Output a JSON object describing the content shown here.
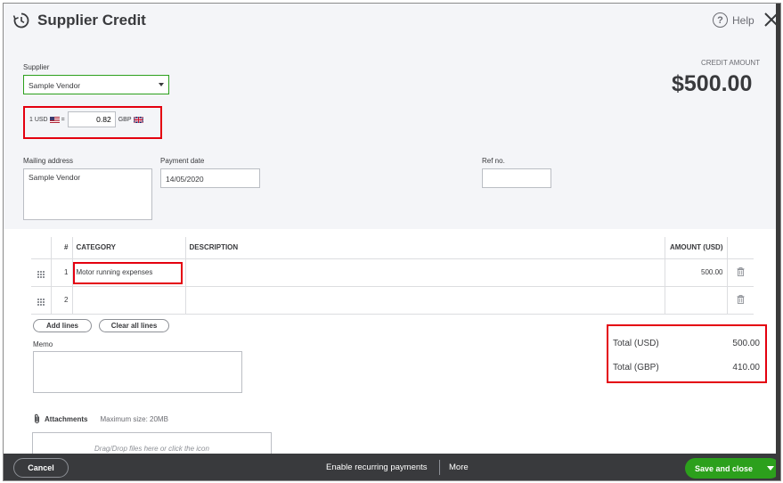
{
  "header": {
    "title": "Supplier Credit",
    "help_label": "Help",
    "help_glyph": "?",
    "icons": [
      "history-icon",
      "help-icon",
      "close-icon"
    ]
  },
  "supplier": {
    "label": "Supplier",
    "value": "Sample Vendor"
  },
  "credit": {
    "label": "CREDIT AMOUNT",
    "amount": "$500.00"
  },
  "exchange": {
    "from_text": "1 USD",
    "equals": "=",
    "rate": "0.82",
    "to_text": "GBP",
    "flags": [
      "us-flag-icon",
      "uk-flag-icon"
    ]
  },
  "mailing": {
    "label": "Mailing address",
    "value": "Sample Vendor"
  },
  "payment_date": {
    "label": "Payment date",
    "value": "14/05/2020"
  },
  "ref": {
    "label": "Ref no.",
    "value": ""
  },
  "table": {
    "headers": {
      "num": "#",
      "category": "CATEGORY",
      "description": "DESCRIPTION",
      "amount": "AMOUNT (USD)"
    },
    "rows": [
      {
        "num": "1",
        "category": "Motor running expenses",
        "description": "",
        "amount": "500.00"
      },
      {
        "num": "2",
        "category": "",
        "description": "",
        "amount": ""
      }
    ]
  },
  "actions": {
    "add_lines": "Add lines",
    "clear_lines": "Clear all lines"
  },
  "memo": {
    "label": "Memo",
    "value": ""
  },
  "totals": {
    "usd_label": "Total (USD)",
    "usd_value": "500.00",
    "gbp_label": "Total (GBP)",
    "gbp_value": "410.00"
  },
  "attachments": {
    "label": "Attachments",
    "max_size": "Maximum size: 20MB",
    "drop_hint": "Drag/Drop files here or click the icon"
  },
  "footer": {
    "cancel": "Cancel",
    "recurring": "Enable recurring payments",
    "more": "More",
    "save": "Save and close"
  },
  "colors": {
    "accent_green": "#2ca01c",
    "highlight_red": "#e4000f",
    "footer_bg": "#393a3d"
  }
}
